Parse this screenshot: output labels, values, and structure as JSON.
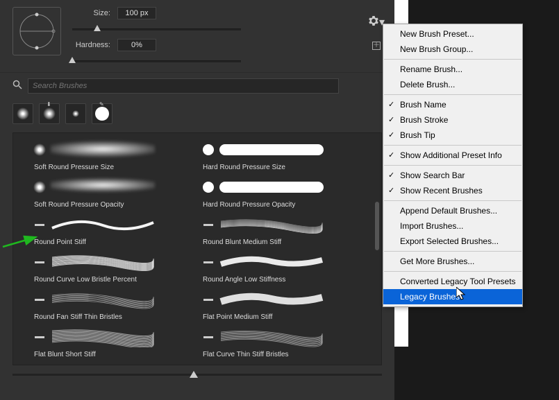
{
  "header": {
    "size_label": "Size:",
    "size_value": "100 px",
    "hardness_label": "Hardness:",
    "hardness_value": "0%"
  },
  "search": {
    "placeholder": "Search Brushes"
  },
  "brushes": [
    {
      "name": "Soft Round Pressure Size"
    },
    {
      "name": "Hard Round Pressure Size"
    },
    {
      "name": "Soft Round Pressure Opacity"
    },
    {
      "name": "Hard Round Pressure Opacity"
    },
    {
      "name": "Round Point Stiff"
    },
    {
      "name": "Round Blunt Medium Stiff"
    },
    {
      "name": "Round Curve Low Bristle Percent"
    },
    {
      "name": "Round Angle Low Stiffness"
    },
    {
      "name": "Round Fan Stiff Thin Bristles"
    },
    {
      "name": "Flat Point Medium Stiff"
    },
    {
      "name": "Flat Blunt Short Stiff"
    },
    {
      "name": "Flat Curve Thin Stiff Bristles"
    }
  ],
  "menu": {
    "items": [
      {
        "label": "New Brush Preset..."
      },
      {
        "label": "New Brush Group..."
      },
      {
        "sep": true
      },
      {
        "label": "Rename Brush..."
      },
      {
        "label": "Delete Brush..."
      },
      {
        "sep": true
      },
      {
        "label": "Brush Name",
        "checked": true
      },
      {
        "label": "Brush Stroke",
        "checked": true
      },
      {
        "label": "Brush Tip",
        "checked": true
      },
      {
        "sep": true
      },
      {
        "label": "Show Additional Preset Info",
        "checked": true
      },
      {
        "sep": true
      },
      {
        "label": "Show Search Bar",
        "checked": true
      },
      {
        "label": "Show Recent Brushes",
        "checked": true
      },
      {
        "sep": true
      },
      {
        "label": "Append Default Brushes..."
      },
      {
        "label": "Import Brushes..."
      },
      {
        "label": "Export Selected Brushes..."
      },
      {
        "sep": true
      },
      {
        "label": "Get More Brushes..."
      },
      {
        "sep": true
      },
      {
        "label": "Converted Legacy Tool Presets"
      },
      {
        "label": "Legacy Brushes",
        "highlight": true
      }
    ]
  }
}
